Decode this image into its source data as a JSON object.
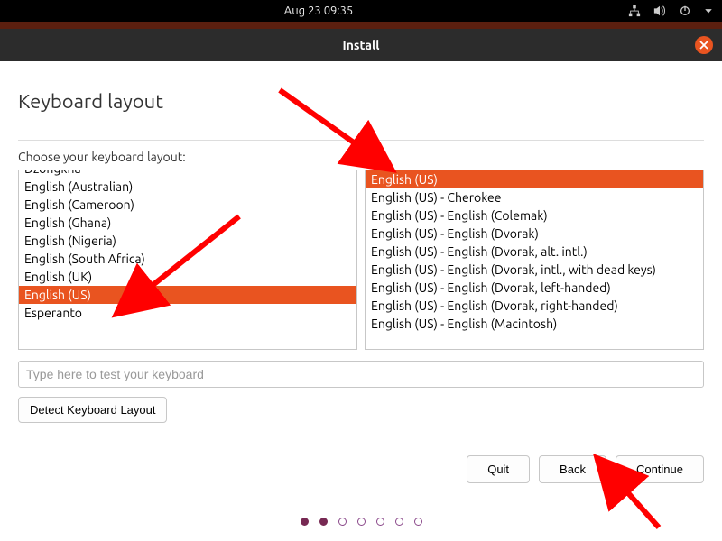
{
  "top_panel": {
    "datetime": "Aug 23  09:35"
  },
  "titlebar": {
    "title": "Install"
  },
  "heading": "Keyboard layout",
  "subhead": "Choose your keyboard layout:",
  "left_list": {
    "items": [
      "Dzongkha",
      "English (Australian)",
      "English (Cameroon)",
      "English (Ghana)",
      "English (Nigeria)",
      "English (South Africa)",
      "English (UK)",
      "English (US)",
      "Esperanto"
    ],
    "selected_index": 7
  },
  "right_list": {
    "items": [
      "English (US)",
      "English (US) - Cherokee",
      "English (US) - English (Colemak)",
      "English (US) - English (Dvorak)",
      "English (US) - English (Dvorak, alt. intl.)",
      "English (US) - English (Dvorak, intl., with dead keys)",
      "English (US) - English (Dvorak, left-handed)",
      "English (US) - English (Dvorak, right-handed)",
      "English (US) - English (Macintosh)"
    ],
    "selected_index": 0
  },
  "test_input": {
    "placeholder": "Type here to test your keyboard",
    "value": ""
  },
  "buttons": {
    "detect": "Detect Keyboard Layout",
    "quit": "Quit",
    "back": "Back",
    "continue": "Continue"
  },
  "progress": {
    "total": 7,
    "filled": 2
  }
}
